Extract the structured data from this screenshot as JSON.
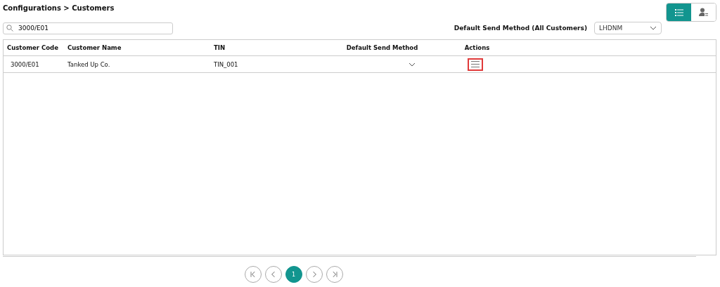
{
  "breadcrumb": "Configurations > Customers",
  "views": [
    {
      "kind": "list",
      "selected": true
    },
    {
      "kind": "contacts",
      "selected": false
    }
  ],
  "search": {
    "value": "3000/E01"
  },
  "default_send_method": {
    "label": "Default Send Method (All Customers)",
    "value": "LHDNM"
  },
  "table": {
    "columns": [
      "Customer Code",
      "Customer Name",
      "TIN",
      "Default Send Method",
      "Actions"
    ],
    "rows": [
      {
        "code": "3000/E01",
        "name": "Tanked Up Co.",
        "tin": "TIN_001",
        "actions_focused": true
      }
    ]
  },
  "pagination": [
    {
      "kind": "first",
      "disabled": false
    },
    {
      "kind": "prev",
      "disabled": false
    },
    {
      "kind": "page",
      "label": "1",
      "selected": true
    },
    {
      "kind": "next",
      "disabled": false
    },
    {
      "kind": "last",
      "disabled": false
    }
  ]
}
